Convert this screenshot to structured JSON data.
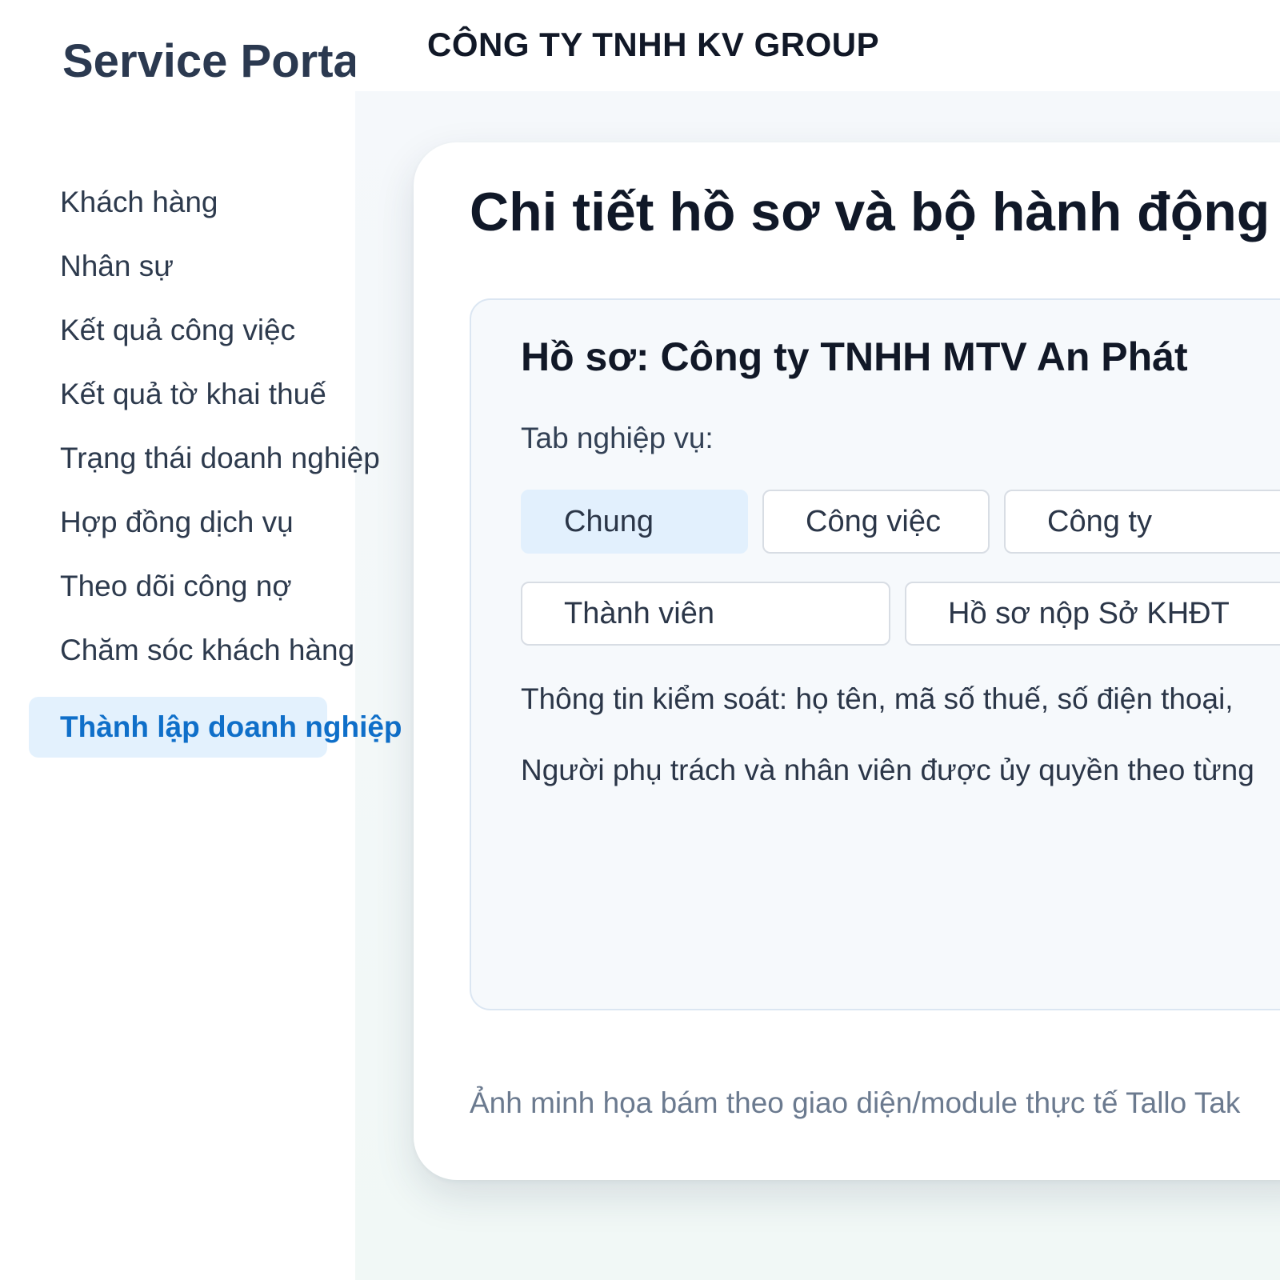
{
  "sidebar": {
    "brand": "Service Portal",
    "items": [
      {
        "label": "Khách hàng"
      },
      {
        "label": "Nhân sự"
      },
      {
        "label": "Kết quả công việc"
      },
      {
        "label": "Kết quả tờ khai thuế"
      },
      {
        "label": "Trạng thái doanh nghiệp"
      },
      {
        "label": "Hợp đồng dịch vụ"
      },
      {
        "label": "Theo dõi công nợ"
      },
      {
        "label": "Chăm sóc khách hàng"
      },
      {
        "label": "Thành lập doanh nghiệp"
      }
    ],
    "active_index": 8
  },
  "header": {
    "company": "CÔNG TY TNHH KV GROUP"
  },
  "main": {
    "title": "Chi tiết hồ sơ và bộ hành động",
    "profile": {
      "title": "Hồ sơ: Công ty TNHH MTV An Phát",
      "tabs_label": "Tab nghiệp vụ:",
      "tabs": [
        {
          "label": "Chung",
          "selected": true
        },
        {
          "label": "Công việc",
          "selected": false
        },
        {
          "label": "Công ty",
          "selected": false
        },
        {
          "label": "Thành viên",
          "selected": false
        },
        {
          "label": "Hồ sơ nộp Sở KHĐT",
          "selected": false
        }
      ],
      "info_lines": [
        "Thông tin kiểm soát: họ tên, mã số thuế, số điện thoại,",
        "Người phụ trách và nhân viên được ủy quyền theo từng"
      ]
    },
    "caption": "Ảnh minh họa bám theo giao diện/module thực tế Tallo Tak"
  },
  "colors": {
    "accent": "#0f6fc9",
    "active_bg": "#e3f1fd",
    "text_dark": "#101828",
    "caption": "#6b7a8f"
  }
}
